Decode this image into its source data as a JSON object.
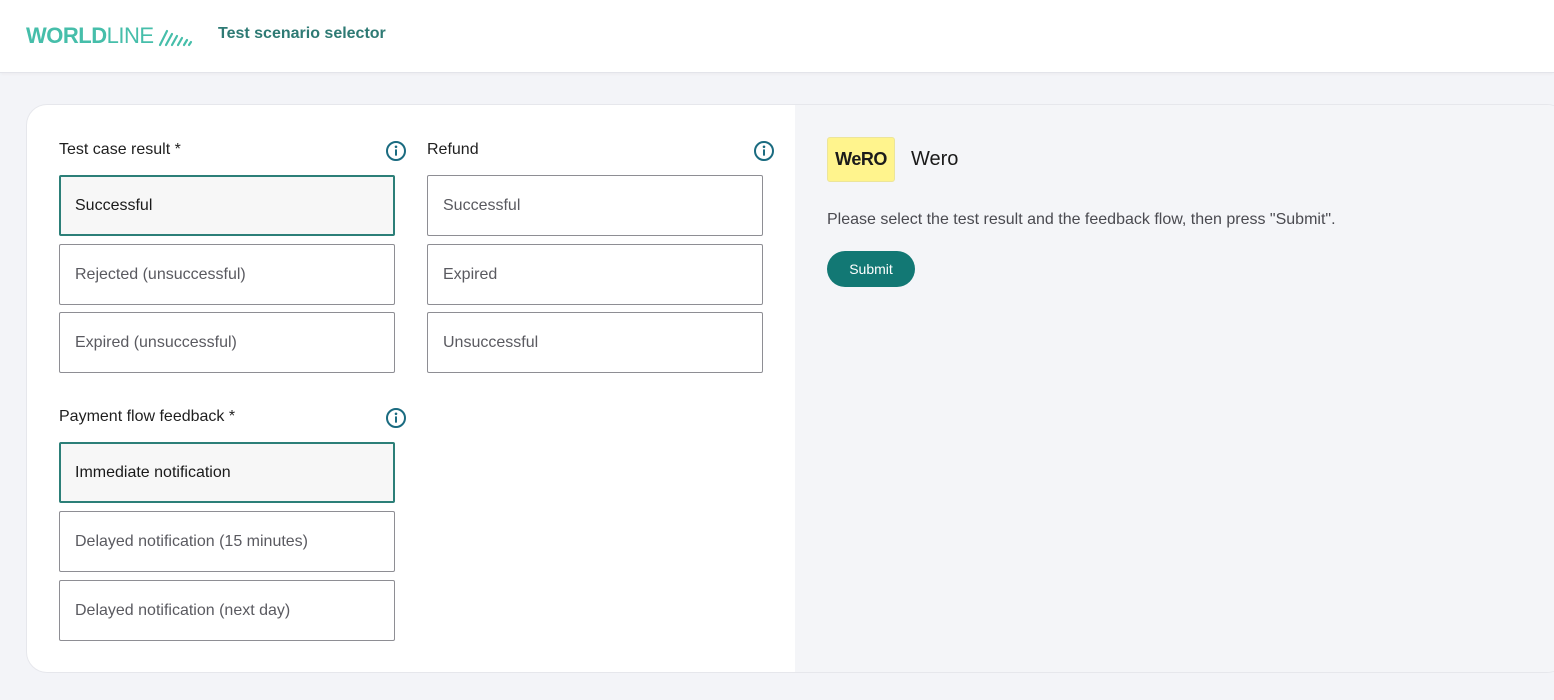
{
  "header": {
    "logo_bold": "WORLD",
    "logo_light": "LINE",
    "title": "Test scenario selector"
  },
  "groups": {
    "test_case": {
      "label": "Test case result *",
      "options": [
        "Successful",
        "Rejected (unsuccessful)",
        "Expired (unsuccessful)"
      ],
      "selected_index": 0
    },
    "refund": {
      "label": "Refund",
      "options": [
        "Successful",
        "Expired",
        "Unsuccessful"
      ],
      "selected_index": null
    },
    "payment_flow": {
      "label": "Payment flow feedback *",
      "options": [
        "Immediate notification",
        "Delayed notification (15 minutes)",
        "Delayed notification (next day)"
      ],
      "selected_index": 0
    }
  },
  "payment_method": {
    "logo_text": "WeRO",
    "name": "Wero",
    "instructions": "Please select the test result and the feedback flow, then press \"Submit\".",
    "submit_label": "Submit"
  },
  "colors": {
    "brand": "#46beaa",
    "accent": "#127874",
    "selected_border": "#2c7f78",
    "wero_bg": "#fff48d"
  },
  "icons": [
    "info-icon",
    "worldline-logo-icon"
  ]
}
